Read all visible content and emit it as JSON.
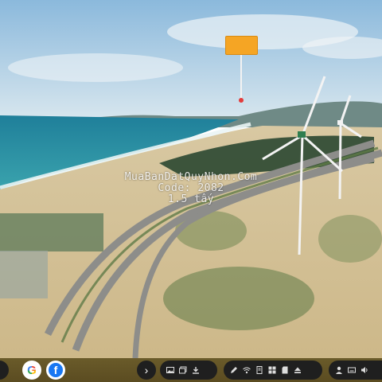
{
  "scene": {
    "description_icon": "aerial-coast-photo"
  },
  "pin": {
    "label": "",
    "color": "#f5a524"
  },
  "watermark": {
    "line1": "MuaBanDatQuyNhon.Com",
    "line2": "Code: 2082",
    "line3": "1.5 tấy"
  },
  "toolbar": {
    "background": "#5f5024",
    "left_buttons": [
      "edge-button",
      "google-icon",
      "facebook-icon"
    ],
    "google_letter": "G",
    "facebook_letter": "f",
    "arrow_glyph": "›",
    "pill_a_icons": [
      "image-icon",
      "photo-stack-icon",
      "download-icon"
    ],
    "pill_b_icons": [
      "pen-icon",
      "wifi-icon",
      "document-icon",
      "grid-icon",
      "sd-card-icon",
      "eject-icon"
    ],
    "pill_c_icons": [
      "person-icon",
      "keyboard-icon",
      "speaker-icon"
    ]
  }
}
